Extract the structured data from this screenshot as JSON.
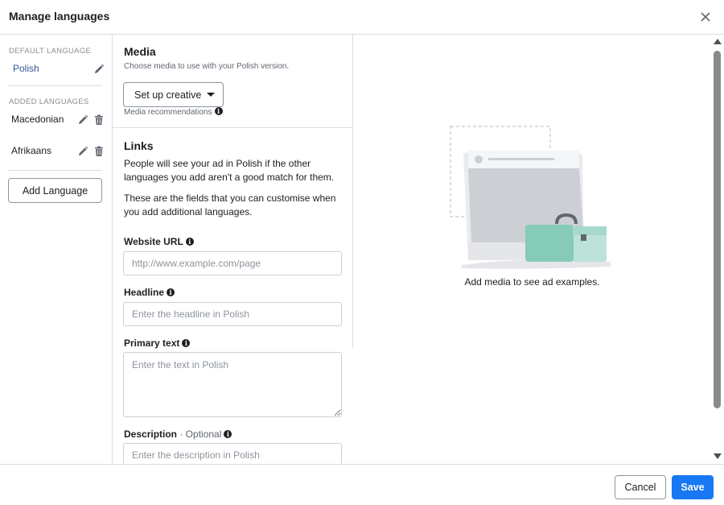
{
  "dialog": {
    "title": "Manage languages",
    "close_icon": "close-icon"
  },
  "sidebar": {
    "default_label": "DEFAULT LANGUAGE",
    "default_language": "Polish",
    "added_label": "ADDED LANGUAGES",
    "added_languages": [
      {
        "name": "Macedonian"
      },
      {
        "name": "Afrikaans"
      }
    ],
    "add_button": "Add Language",
    "link_color": "#385898"
  },
  "media": {
    "title": "Media",
    "subtitle": "Choose media to use with your Polish version.",
    "setup_button": "Set up creative",
    "recommendations": "Media recommendations"
  },
  "links": {
    "title": "Links",
    "para1": "People will see your ad in Polish if the other languages you add aren't a good match for them.",
    "para2": "These are the fields that you can customise when you add additional languages.",
    "website_url": {
      "label": "Website URL",
      "placeholder": "http://www.example.com/page",
      "value": ""
    },
    "headline": {
      "label": "Headline",
      "placeholder": "Enter the headline in Polish",
      "value": ""
    },
    "primary_text": {
      "label": "Primary text",
      "placeholder": "Enter the text in Polish",
      "value": ""
    },
    "description": {
      "label": "Description",
      "optional": " · Optional",
      "placeholder": "Enter the description in Polish",
      "value": ""
    }
  },
  "preview": {
    "text": "Add media to see ad examples."
  },
  "footer": {
    "cancel": "Cancel",
    "save": "Save",
    "save_color": "#1877f2"
  }
}
